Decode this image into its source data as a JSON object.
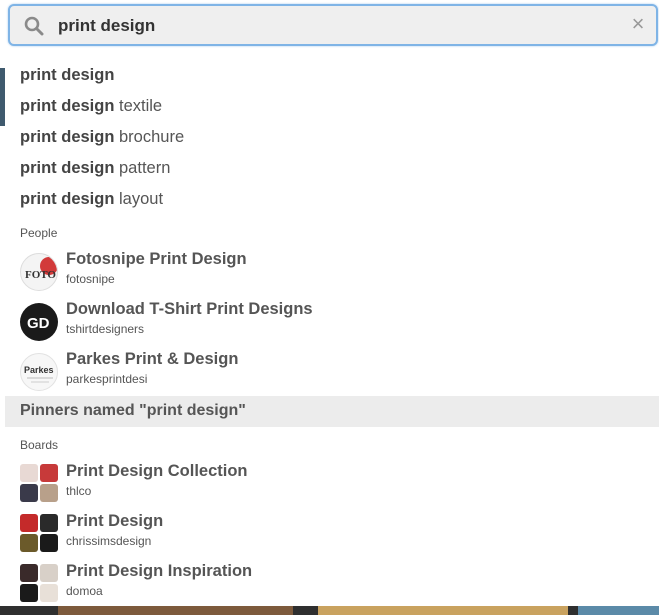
{
  "search": {
    "query": "print design",
    "clear_label": "×"
  },
  "suggestions": [
    {
      "bold": "print design",
      "rest": ""
    },
    {
      "bold": "print design",
      "rest": " textile"
    },
    {
      "bold": "print design",
      "rest": " brochure"
    },
    {
      "bold": "print design",
      "rest": " pattern"
    },
    {
      "bold": "print design",
      "rest": " layout"
    }
  ],
  "people": {
    "label": "People",
    "items": [
      {
        "name": "Fotosnipe Print Design",
        "username": "fotosnipe",
        "avatar_text": "FOTO"
      },
      {
        "name": "Download T-Shirt Print Designs",
        "username": "tshirtdesigners",
        "avatar_text": "GD"
      },
      {
        "name": "Parkes Print & Design",
        "username": "parkesprintdesi",
        "avatar_text": "Parkes"
      }
    ]
  },
  "pinners": {
    "label": "Pinners named \"print design\""
  },
  "boards": {
    "label": "Boards",
    "items": [
      {
        "name": "Print Design Collection",
        "owner": "thlco",
        "colors": [
          "#e8d9d4",
          "#c73a3a",
          "#3a3a4a",
          "#b8a08a"
        ]
      },
      {
        "name": "Print Design",
        "owner": "chrissimsdesign",
        "colors": [
          "#c42a2a",
          "#2a2a2a",
          "#6b5a2a",
          "#1a1a1a"
        ]
      },
      {
        "name": "Print Design Inspiration",
        "owner": "domoa",
        "colors": [
          "#3a2a2a",
          "#d8d0c8",
          "#1a1a1a",
          "#e8e0d8"
        ]
      }
    ]
  }
}
